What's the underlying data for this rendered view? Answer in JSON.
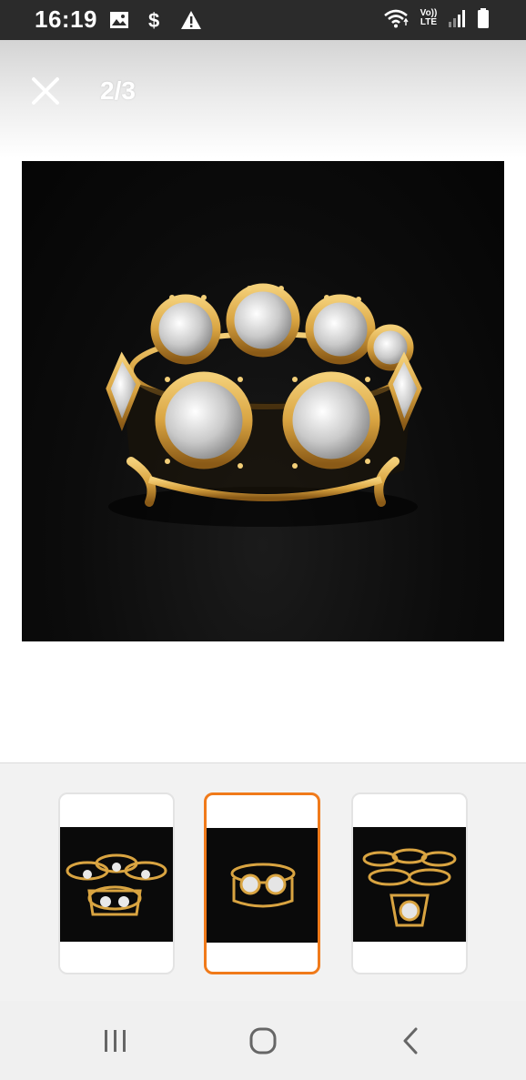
{
  "status_bar": {
    "time": "16:19",
    "left_icons": [
      "image-icon",
      "dollar-icon",
      "warning-icon"
    ],
    "network_label_top": "Vo))",
    "network_label_bottom": "LTE",
    "right_icons": [
      "wifi-icon",
      "volte-icon",
      "signal-icon",
      "battery-icon"
    ]
  },
  "viewer": {
    "close_icon": "close-icon",
    "counter": "2/3"
  },
  "thumbnails": [
    {
      "selected": false,
      "subject": "set of crystal crown candle holders"
    },
    {
      "selected": true,
      "subject": "single gold crystal crown candle holder"
    },
    {
      "selected": false,
      "subject": "stacked crystal crown candle holders"
    }
  ],
  "nav_bar": {
    "icons": [
      "recent-apps-icon",
      "home-icon",
      "back-icon"
    ]
  },
  "colors": {
    "status_bar_bg": "#2b2b2b",
    "selected_accent": "#f07a1a",
    "gold": "#d9a441",
    "photo_bg": "#0a0a0a"
  }
}
